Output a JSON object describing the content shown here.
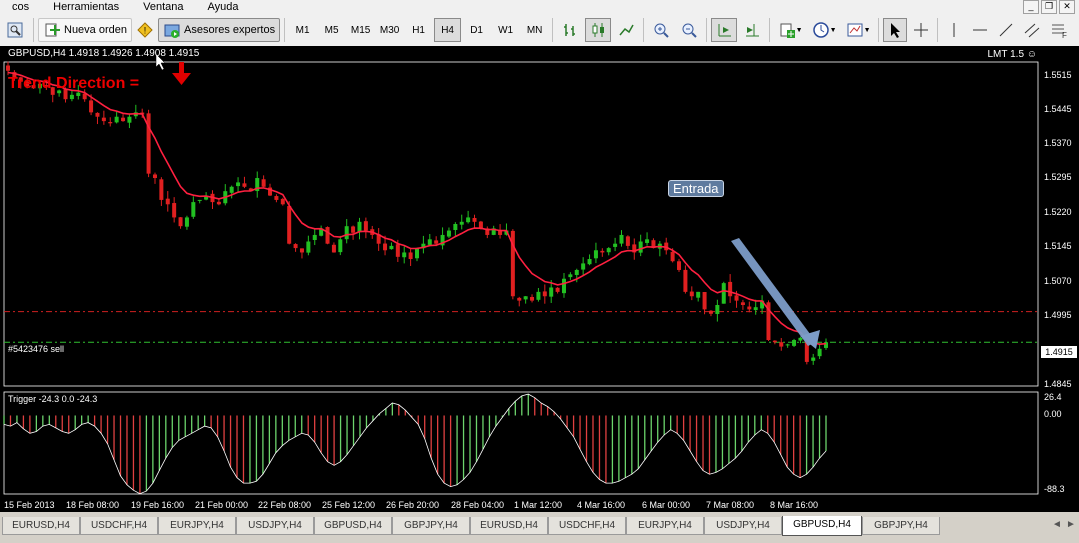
{
  "menu": {
    "items": [
      "cos",
      "Herramientas",
      "Ventana",
      "Ayuda"
    ]
  },
  "toolbar": {
    "new_order": "Nueva orden",
    "experts": "Asesores expertos",
    "timeframes": [
      "M1",
      "M5",
      "M15",
      "M30",
      "H1",
      "H4",
      "D1",
      "W1",
      "MN"
    ],
    "active_timeframe": "H4"
  },
  "chart": {
    "title": "GBPUSD,H4  1.4918 1.4926 1.4908 1.4915",
    "lmt": "LMT 1.5 ☺",
    "trend_label": "Trend Direction =",
    "order_label": "#5423476 sell",
    "annotation": "Entrada",
    "current_price": "1.4915",
    "price_ticks": [
      "1.5515",
      "1.5445",
      "1.5370",
      "1.5295",
      "1.5220",
      "1.5145",
      "1.5070",
      "1.4995",
      "1.4845"
    ],
    "indicator_label": "Trigger -24.3 0.0 -24.3",
    "indicator_ticks": [
      "26.4",
      "0.00",
      "-88.3"
    ],
    "dates": [
      "15 Feb 2013",
      "18 Feb 08:00",
      "19 Feb 16:00",
      "21 Feb 00:00",
      "22 Feb 08:00",
      "25 Feb 12:00",
      "26 Feb 20:00",
      "28 Feb 04:00",
      "1 Mar 12:00",
      "4 Mar 16:00",
      "6 Mar 00:00",
      "7 Mar 08:00",
      "8 Mar 16:00"
    ],
    "colors": {
      "bull": "#22c022",
      "bear": "#e02020",
      "ma": "#ff2040",
      "hist_bull": "#6cd46c",
      "hist_bear": "#e04040",
      "sell_line": "#d02020",
      "order_line": "#30c030"
    }
  },
  "chart_data": {
    "type": "candlestick",
    "symbol": "GBPUSD",
    "timeframe": "H4",
    "ylim": [
      1.4815,
      1.5555
    ],
    "closes": [
      1.5535,
      1.552,
      1.551,
      1.55,
      1.5495,
      1.5505,
      1.55,
      1.548,
      1.549,
      1.547,
      1.548,
      1.5485,
      1.547,
      1.544,
      1.543,
      1.542,
      1.5415,
      1.543,
      1.542,
      1.543,
      1.544,
      1.5435,
      1.53,
      1.529,
      1.524,
      1.523,
      1.52,
      1.518,
      1.52,
      1.5235,
      1.524,
      1.525,
      1.5235,
      1.523,
      1.526,
      1.527,
      1.528,
      1.527,
      1.526,
      1.529,
      1.527,
      1.525,
      1.524,
      1.523,
      1.514,
      1.513,
      1.512,
      1.5145,
      1.516,
      1.5175,
      1.514,
      1.512,
      1.515,
      1.518,
      1.5165,
      1.519,
      1.517,
      1.516,
      1.514,
      1.5125,
      1.5135,
      1.511,
      1.512,
      1.5105,
      1.513,
      1.514,
      1.515,
      1.514,
      1.516,
      1.517,
      1.5185,
      1.519,
      1.52,
      1.519,
      1.5175,
      1.516,
      1.5175,
      1.516,
      1.517,
      1.502,
      1.501,
      1.502,
      1.501,
      1.503,
      1.502,
      1.504,
      1.503,
      1.506,
      1.507,
      1.508,
      1.5095,
      1.5105,
      1.5125,
      1.512,
      1.513,
      1.514,
      1.516,
      1.5135,
      1.512,
      1.5145,
      1.515,
      1.513,
      1.514,
      1.5125,
      1.51,
      1.508,
      1.503,
      1.502,
      1.503,
      1.499,
      1.498,
      1.5,
      1.505,
      1.502,
      1.501,
      1.5,
      1.499,
      1.4995,
      1.501,
      1.492,
      1.4915,
      1.4905,
      1.491,
      1.492,
      1.4925,
      1.487,
      1.488,
      1.49,
      1.4915
    ],
    "ma_start": 1.553,
    "sell_level": 1.4985,
    "order_level": 1.4915,
    "indicator": {
      "ylim": [
        -88.3,
        26.4
      ],
      "values": [
        -10,
        -12,
        -8,
        -15,
        -20,
        -18,
        -12,
        -10,
        -14,
        -18,
        -20,
        -16,
        -10,
        -8,
        -12,
        -20,
        -32,
        -50,
        -68,
        -78,
        -84,
        -88,
        -85,
        -76,
        -62,
        -48,
        -36,
        -28,
        -24,
        -20,
        -16,
        -12,
        -14,
        -24,
        -40,
        -58,
        -70,
        -76,
        -76,
        -74,
        -66,
        -54,
        -42,
        -34,
        -28,
        -24,
        -20,
        -22,
        -30,
        -42,
        -52,
        -56,
        -52,
        -44,
        -34,
        -24,
        -14,
        -6,
        2,
        8,
        14,
        12,
        6,
        -2,
        -10,
        -26,
        -48,
        -66,
        -76,
        -80,
        -78,
        -72,
        -64,
        -52,
        -38,
        -24,
        -12,
        -2,
        8,
        16,
        22,
        24,
        20,
        14,
        10,
        4,
        -4,
        -14,
        -24,
        -38,
        -52,
        -64,
        -72,
        -76,
        -76,
        -74,
        -70,
        -66,
        -60,
        -50,
        -40,
        -30,
        -22,
        -16,
        -20,
        -28,
        -40,
        -52,
        -62,
        -66,
        -64,
        -60,
        -54,
        -48,
        -40,
        -30,
        -22,
        -16,
        -20,
        -30,
        -44,
        -58,
        -66,
        -70,
        -66,
        -58,
        -48,
        -40
      ]
    }
  },
  "tabs": {
    "items": [
      "EURUSD,H4",
      "USDCHF,H4",
      "EURJPY,H4",
      "USDJPY,H4",
      "GBPUSD,H4",
      "GBPJPY,H4",
      "EURUSD,H4",
      "USDCHF,H4",
      "EURJPY,H4",
      "USDJPY,H4",
      "GBPUSD,H4",
      "GBPJPY,H4"
    ],
    "active_index": 10
  }
}
